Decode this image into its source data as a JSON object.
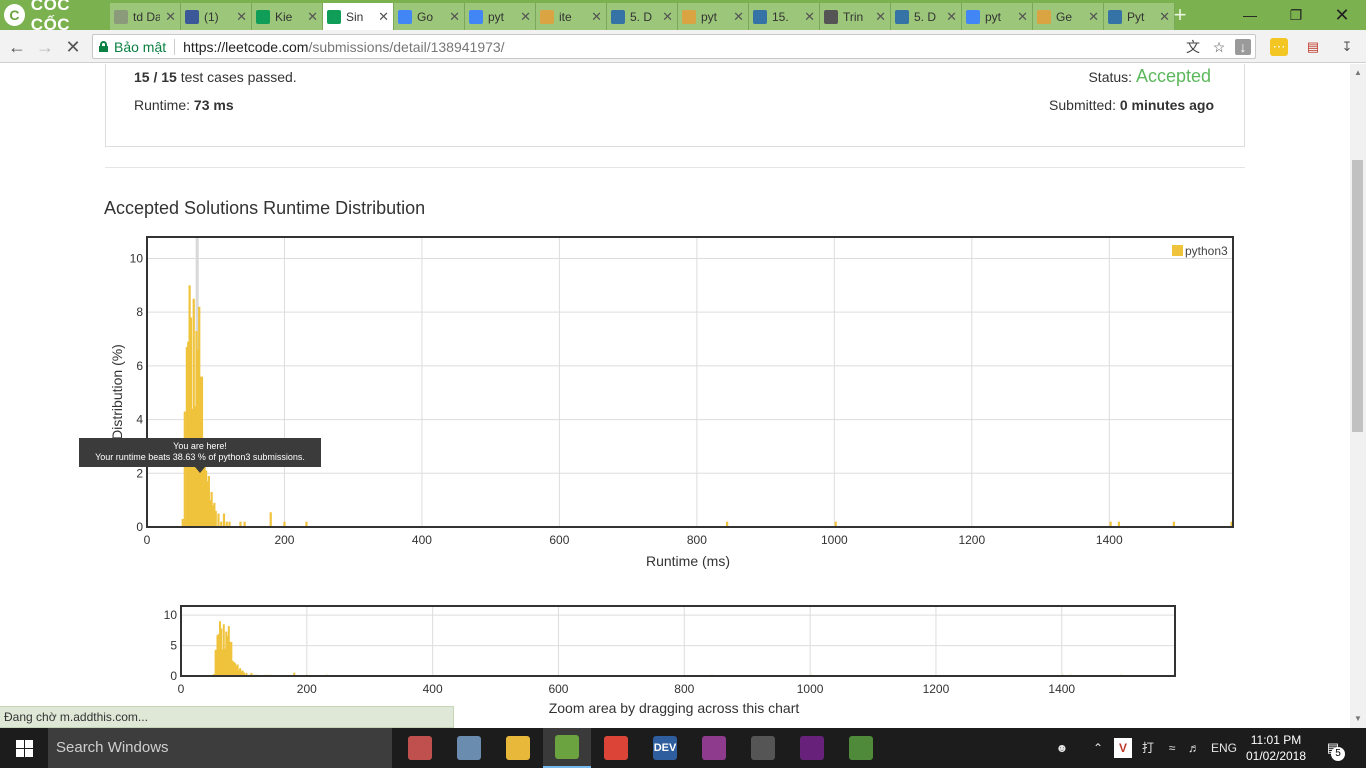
{
  "browser": {
    "brand": "CỐC CỐC",
    "tabs": [
      {
        "label": "td  Dat",
        "icon": "td-icon",
        "color": "#8a9a7a",
        "active": false
      },
      {
        "label": "(1)",
        "icon": "facebook-icon",
        "color": "#3b5998",
        "active": false
      },
      {
        "label": "Kie",
        "icon": "sheets-icon",
        "color": "#0f9d58",
        "active": false
      },
      {
        "label": "Sin",
        "icon": "sheets-active-icon",
        "color": "#0f9d58",
        "active": true
      },
      {
        "label": "Go",
        "icon": "google-translate-icon",
        "color": "#4285f4",
        "active": false
      },
      {
        "label": "pyt",
        "icon": "google-icon",
        "color": "#4285f4",
        "active": false
      },
      {
        "label": "ite",
        "icon": "leetcode-icon",
        "color": "#d9a441",
        "active": false
      },
      {
        "label": "5. D",
        "icon": "python-icon",
        "color": "#3572a5",
        "active": false
      },
      {
        "label": "pyt",
        "icon": "leetcode-icon",
        "color": "#d9a441",
        "active": false
      },
      {
        "label": "15.",
        "icon": "python-icon",
        "color": "#3572a5",
        "active": false
      },
      {
        "label": "Trin",
        "icon": "code-icon",
        "color": "#555555",
        "active": false
      },
      {
        "label": "5. D",
        "icon": "python-icon",
        "color": "#3572a5",
        "active": false
      },
      {
        "label": "pyt",
        "icon": "google-icon",
        "color": "#4285f4",
        "active": false
      },
      {
        "label": "Ge",
        "icon": "leetcode-icon",
        "color": "#d9a441",
        "active": false
      },
      {
        "label": "Pyt",
        "icon": "python-doc-icon",
        "color": "#3572a5",
        "active": false
      }
    ],
    "secure_label": "Bảo mật",
    "url_host": "https://leetcode.com",
    "url_path": "/submissions/detail/138941973/"
  },
  "submission": {
    "passed_a": "15",
    "slash": " / ",
    "passed_b": "15",
    "passed_suffix": " test cases passed.",
    "status_label": "Status: ",
    "status_value": "Accepted",
    "runtime_label": "Runtime: ",
    "runtime_value": "73 ms",
    "submitted_label": "Submitted: ",
    "submitted_value": "0 minutes ago"
  },
  "section_title": "Accepted Solutions Runtime Distribution",
  "tooltip": {
    "line1": "You are here!",
    "line2": "Your runtime beats 38.63 % of python3 submissions."
  },
  "colors": {
    "bar": "#f0c33c",
    "accepted": "#5cb85c",
    "marker": "#d8d8d8"
  },
  "chart_data": [
    {
      "type": "bar",
      "title": "Accepted Solutions Runtime Distribution",
      "xlabel": "Runtime (ms)",
      "ylabel": "Distribution (%)",
      "xlim": [
        0,
        1580
      ],
      "ylim": [
        0,
        10.8
      ],
      "xticks": [
        0,
        200,
        400,
        600,
        800,
        1000,
        1200,
        1400
      ],
      "yticks": [
        0,
        2,
        4,
        6,
        8,
        10
      ],
      "legend": "top-right",
      "grid": true,
      "marker_x": 73,
      "series": [
        {
          "name": "python3",
          "x": [
            52,
            55,
            58,
            60,
            62,
            64,
            66,
            68,
            70,
            72,
            74,
            76,
            78,
            80,
            82,
            84,
            86,
            88,
            90,
            92,
            94,
            96,
            98,
            100,
            104,
            108,
            112,
            116,
            120,
            136,
            142,
            180,
            200,
            232,
            844,
            1002,
            1402,
            1414,
            1494,
            1578
          ],
          "values": [
            0.3,
            4.3,
            6.7,
            6.9,
            9.0,
            7.8,
            4.4,
            8.5,
            4.5,
            7.3,
            6.6,
            8.2,
            5.6,
            5.6,
            2.5,
            2.3,
            2.1,
            1.7,
            1.9,
            1.0,
            1.3,
            0.8,
            0.9,
            0.6,
            0.5,
            0.2,
            0.5,
            0.2,
            0.2,
            0.2,
            0.2,
            0.55,
            0.2,
            0.2,
            0.2,
            0.2,
            0.2,
            0.2,
            0.2,
            0.2
          ]
        }
      ]
    },
    {
      "type": "bar",
      "title": "",
      "xlabel": "Zoom area by dragging across this chart",
      "ylabel": "",
      "xlim": [
        0,
        1580
      ],
      "ylim": [
        0,
        11.5
      ],
      "xticks": [
        0,
        200,
        400,
        600,
        800,
        1000,
        1200,
        1400
      ],
      "yticks": [
        0,
        5,
        10
      ],
      "grid": true,
      "series": [
        {
          "name": "",
          "x": [
            52,
            55,
            58,
            60,
            62,
            64,
            66,
            68,
            70,
            72,
            74,
            76,
            78,
            80,
            82,
            84,
            86,
            88,
            90,
            92,
            94,
            96,
            98,
            100,
            104,
            108,
            112,
            116,
            120,
            136,
            142,
            180,
            200,
            232,
            844,
            1002,
            1402,
            1414,
            1494,
            1578
          ],
          "values": [
            0.3,
            4.3,
            6.7,
            6.9,
            9.0,
            7.8,
            4.4,
            8.5,
            4.5,
            7.3,
            6.6,
            8.2,
            5.6,
            5.6,
            2.5,
            2.3,
            2.1,
            1.7,
            1.9,
            1.0,
            1.3,
            0.8,
            0.9,
            0.6,
            0.5,
            0.2,
            0.5,
            0.2,
            0.2,
            0.2,
            0.2,
            0.55,
            0.2,
            0.2,
            0.2,
            0.2,
            0.2,
            0.2,
            0.2,
            0.2
          ]
        }
      ]
    }
  ],
  "status_bubble": "Đang chờ m.addthis.com...",
  "taskbar": {
    "search_placeholder": "Search Windows",
    "apps": [
      {
        "name": "paint-icon",
        "label": "",
        "color": "#c0504d"
      },
      {
        "name": "photos-icon",
        "label": "",
        "color": "#6a8caf"
      },
      {
        "name": "file-explorer-icon",
        "label": "",
        "color": "#e8b83a"
      },
      {
        "name": "coccoc-icon",
        "label": "",
        "color": "#6aa33f"
      },
      {
        "name": "chrome-icon",
        "label": "",
        "color": "#db4437"
      },
      {
        "name": "devcpp-icon",
        "label": "DEV",
        "color": "#2f5e9e"
      },
      {
        "name": "winrar-icon",
        "label": "",
        "color": "#8e3b8e"
      },
      {
        "name": "calculator-icon",
        "label": "",
        "color": "#555555"
      },
      {
        "name": "visual-studio-icon",
        "label": "",
        "color": "#68217a"
      },
      {
        "name": "app-icon",
        "label": "",
        "color": "#4f8a3b"
      }
    ],
    "tray_lang": "ENG",
    "tray_ime": "V",
    "time": "11:01 PM",
    "date": "01/02/2018",
    "notifications": "5"
  }
}
